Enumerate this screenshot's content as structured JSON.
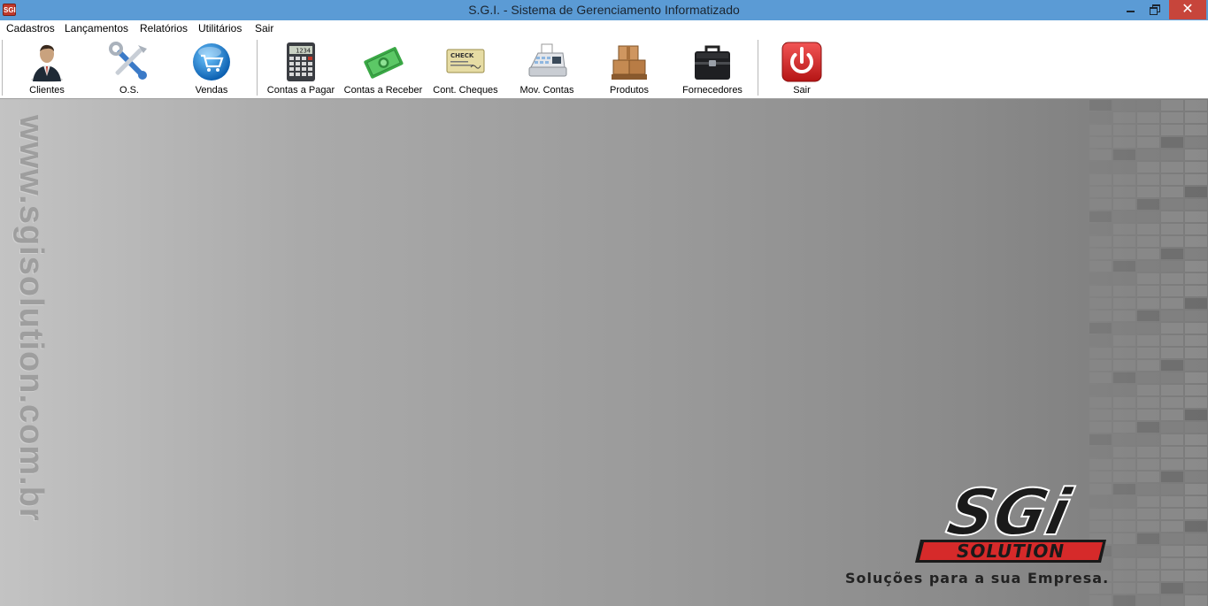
{
  "window": {
    "title": "S.G.I. - Sistema de Gerenciamento Informatizado",
    "app_icon_text": "SGI"
  },
  "menu": [
    {
      "label": "Cadastros"
    },
    {
      "label": "Lançamentos"
    },
    {
      "label": "Relatórios"
    },
    {
      "label": "Utilitários"
    },
    {
      "label": "Sair"
    }
  ],
  "toolbar": {
    "clientes": "Clientes",
    "os": "O.S.",
    "vendas": "Vendas",
    "contas_pagar": "Contas a Pagar",
    "contas_receber": "Contas a Receber",
    "cheques": "Cont. Cheques",
    "mov_contas": "Mov. Contas",
    "produtos": "Produtos",
    "fornecedores": "Fornecedores",
    "sair": "Sair"
  },
  "calculator_display": "1234",
  "check_icon_text": "CHECK",
  "background": {
    "side_url": "www.sgisolution.com.br",
    "logo_main": "SGi",
    "logo_sub": "SOLUTION",
    "tagline": "Soluções para a sua Empresa."
  },
  "colors": {
    "titlebar": "#5b9bd5",
    "close_button": "#c7453b",
    "logo_red": "#d62a2a"
  }
}
